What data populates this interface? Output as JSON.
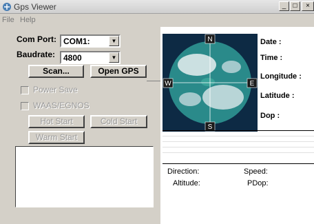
{
  "window": {
    "title": "Gps Viewer",
    "minimize": "_",
    "maximize": "□",
    "close": "×"
  },
  "menu": [
    {
      "label": "File"
    },
    {
      "label": "Help"
    }
  ],
  "controls": {
    "com_port_label": "Com Port:",
    "com_port_value": "COM1:",
    "baudrate_label": "Baudrate:",
    "baudrate_value": "4800",
    "scan_label": "Scan...",
    "open_label": "Open GPS",
    "power_save_label": "Power Save",
    "waas_label": "WAAS/EGNOS",
    "hot_start_label": "Hot Start",
    "cold_start_label": "Cold Start",
    "warm_start_label": "Warm Start",
    "log_text": ""
  },
  "compass": {
    "north": "N",
    "south": "S",
    "east": "E",
    "west": "W"
  },
  "info": [
    {
      "label": "Date",
      "value": ""
    },
    {
      "label": "Time",
      "value": ""
    },
    {
      "label": "Longitude",
      "value": ""
    },
    {
      "label": "Latitude",
      "value": ""
    },
    {
      "label": "Dop",
      "value": ""
    }
  ],
  "info_colon": ":",
  "stats": {
    "direction": "Direction:",
    "speed": "Speed:",
    "altitude": "Altitude:",
    "pdop": "PDop:"
  },
  "colors": {
    "globe_ocean": "#2a8a8a",
    "globe_land": "#e8eef0",
    "panel_bg": "#ffffff",
    "chrome": "#d4d0c8"
  }
}
